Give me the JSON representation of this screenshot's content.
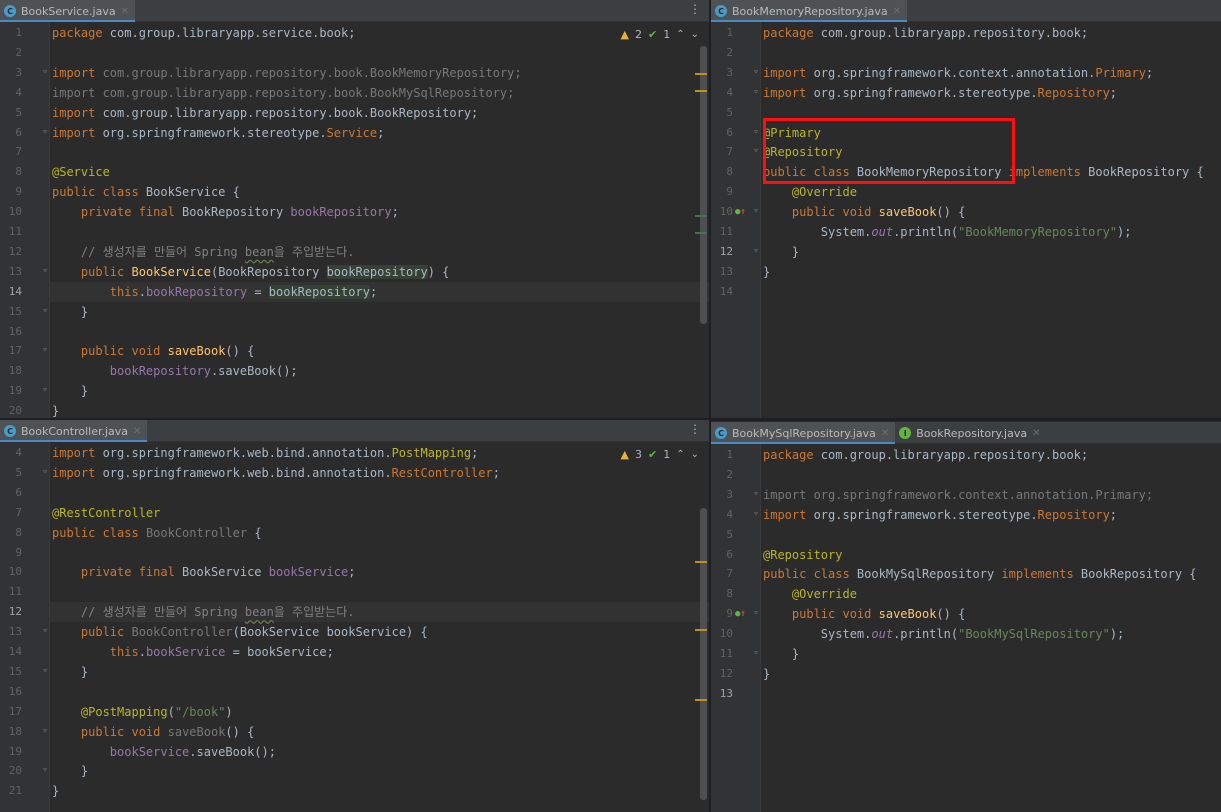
{
  "panes": {
    "tl": {
      "tabs": [
        {
          "label": "BookService.java",
          "kind": "class",
          "active": true
        }
      ],
      "inspection": {
        "warnings": "2",
        "ok": "1"
      },
      "lines": [
        {
          "n": "1",
          "html": "<span class=\"kw\">package</span> com.group.libraryapp.service.book;"
        },
        {
          "n": "2",
          "html": ""
        },
        {
          "n": "3",
          "html": "<span class=\"unused\"><span class=\"kw\">import</span> com.group.libraryapp.repository.book.BookMemoryRepository;</span>",
          "fold": true
        },
        {
          "n": "4",
          "html": "<span class=\"unused\">import com.group.libraryapp.repository.book.BookMySqlRepository;</span>"
        },
        {
          "n": "5",
          "html": "<span class=\"kw\">import</span> com.group.libraryapp.repository.book.BookRepository;"
        },
        {
          "n": "6",
          "html": "<span class=\"kw\">import</span> org.springframework.stereotype.<span class=\"kw\">Service</span>;",
          "fold": true
        },
        {
          "n": "7",
          "html": ""
        },
        {
          "n": "8",
          "html": "<span class=\"ann\">@Service</span>"
        },
        {
          "n": "9",
          "html": "<span class=\"kw\">public class</span> BookService {"
        },
        {
          "n": "10",
          "html": "    <span class=\"kw\">private final</span> BookRepository <span class=\"fld\">bookRepository</span>;"
        },
        {
          "n": "11",
          "html": ""
        },
        {
          "n": "12",
          "html": "    <span class=\"cmt\">// 생성자를 만들어 Spring <span class=\"und\">bean</span>을 주입받는다.</span>"
        },
        {
          "n": "13",
          "html": "    <span class=\"kw\">public</span> <span class=\"fn\">BookService</span>(BookRepository <span class=\"hl\">bookRepository</span>) {",
          "fold": true
        },
        {
          "n": "14",
          "html": "        <span class=\"kw\">this</span>.<span class=\"fld\">bookRepository</span> = <span class=\"hl\">bookRepository</span>;",
          "current": true
        },
        {
          "n": "15",
          "html": "    }",
          "fold": true
        },
        {
          "n": "16",
          "html": ""
        },
        {
          "n": "17",
          "html": "    <span class=\"kw\">public void</span> <span class=\"fn\">saveBook</span>() {",
          "fold": true
        },
        {
          "n": "18",
          "html": "        <span class=\"fld\">bookRepository</span>.saveBook();"
        },
        {
          "n": "19",
          "html": "    }",
          "fold": true
        },
        {
          "n": "20",
          "html": "}"
        }
      ]
    },
    "tr": {
      "tabs": [
        {
          "label": "BookMemoryRepository.java",
          "kind": "class",
          "active": true
        }
      ],
      "lines": [
        {
          "n": "1",
          "html": "<span class=\"kw\">package</span> com.group.libraryapp.repository.book;"
        },
        {
          "n": "2",
          "html": ""
        },
        {
          "n": "3",
          "html": "<span class=\"kw\">import</span> org.springframework.context.annotation.<span class=\"kw\">Primary</span>;",
          "fold": true
        },
        {
          "n": "4",
          "html": "<span class=\"kw\">import</span> org.springframework.stereotype.<span class=\"kw\">Repository</span>;",
          "fold": true
        },
        {
          "n": "5",
          "html": ""
        },
        {
          "n": "6",
          "html": "<span class=\"ann\">@Primary</span>",
          "fold": true
        },
        {
          "n": "7",
          "html": "<span class=\"ann\">@Repository</span>",
          "fold": true
        },
        {
          "n": "8",
          "html": "<span class=\"kw\">public class</span> BookMemoryRepository <span class=\"kw\">implements</span> BookRepository {"
        },
        {
          "n": "9",
          "html": "    <span class=\"ann\">@Override</span>"
        },
        {
          "n": "10",
          "html": "    <span class=\"kw\">public void</span> <span class=\"fn\">saveBook</span>() {",
          "fold": true,
          "impl": true
        },
        {
          "n": "11",
          "html": "        System.<span class=\"ital\">out</span>.println(<span class=\"str\">\"BookMemoryRepository\"</span>);"
        },
        {
          "n": "12",
          "html": "    }",
          "fold": true,
          "cur": true
        },
        {
          "n": "13",
          "html": "}"
        },
        {
          "n": "14",
          "html": ""
        }
      ]
    },
    "bl": {
      "tabs": [
        {
          "label": "BookController.java",
          "kind": "class",
          "active": true
        }
      ],
      "inspection": {
        "warnings": "3",
        "ok": "1"
      },
      "lines": [
        {
          "n": "4",
          "html": "<span class=\"kw\">import</span> org.springframework.web.bind.annotation.<span class=\"ann\">PostMapping</span>;"
        },
        {
          "n": "5",
          "html": "<span class=\"kw\">import</span> org.springframework.web.bind.annotation.<span class=\"kw\">RestController</span>;",
          "fold": true
        },
        {
          "n": "6",
          "html": ""
        },
        {
          "n": "7",
          "html": "<span class=\"ann\">@RestController</span>"
        },
        {
          "n": "8",
          "html": "<span class=\"kw\">public class</span> <span class=\"unused\">BookController</span> {"
        },
        {
          "n": "9",
          "html": ""
        },
        {
          "n": "10",
          "html": "    <span class=\"kw\">private final</span> BookService <span class=\"fld\">bookService</span>;"
        },
        {
          "n": "11",
          "html": ""
        },
        {
          "n": "12",
          "html": "    <span class=\"cmt\">// 생성자를 만들어 Spring <span class=\"und\">bean</span>을 주입받는다.</span>",
          "current": true
        },
        {
          "n": "13",
          "html": "    <span class=\"kw\">public</span> <span class=\"unused\">BookController</span>(BookService bookService) {",
          "fold": true
        },
        {
          "n": "14",
          "html": "        <span class=\"kw\">this</span>.<span class=\"fld\">bookService</span> = bookService;"
        },
        {
          "n": "15",
          "html": "    }",
          "fold": true
        },
        {
          "n": "16",
          "html": ""
        },
        {
          "n": "17",
          "html": "    <span class=\"ann\">@PostMapping</span>(<span class=\"str\">\"/book\"</span>)"
        },
        {
          "n": "18",
          "html": "    <span class=\"kw\">public void</span> <span class=\"unused\">saveBook</span>() {",
          "fold": true
        },
        {
          "n": "19",
          "html": "        <span class=\"fld\">bookService</span>.saveBook();"
        },
        {
          "n": "20",
          "html": "    }",
          "fold": true
        },
        {
          "n": "21",
          "html": "}"
        }
      ]
    },
    "br": {
      "tabs": [
        {
          "label": "BookMySqlRepository.java",
          "kind": "class",
          "active": true
        },
        {
          "label": "BookRepository.java",
          "kind": "iface",
          "active": false
        }
      ],
      "lines": [
        {
          "n": "1",
          "html": "<span class=\"kw\">package</span> com.group.libraryapp.repository.book;"
        },
        {
          "n": "2",
          "html": ""
        },
        {
          "n": "3",
          "html": "<span class=\"unused\">import org.springframework.context.annotation.Primary;</span>",
          "fold": true
        },
        {
          "n": "4",
          "html": "<span class=\"kw\">import</span> org.springframework.stereotype.<span class=\"kw\">Repository</span>;",
          "fold": true
        },
        {
          "n": "5",
          "html": ""
        },
        {
          "n": "6",
          "html": "<span class=\"ann\">@Repository</span>"
        },
        {
          "n": "7",
          "html": "<span class=\"kw\">public class</span> BookMySqlRepository <span class=\"kw\">implements</span> BookRepository {"
        },
        {
          "n": "8",
          "html": "    <span class=\"ann\">@Override</span>"
        },
        {
          "n": "9",
          "html": "    <span class=\"kw\">public void</span> <span class=\"fn\">saveBook</span>() {",
          "fold": true,
          "impl": true
        },
        {
          "n": "10",
          "html": "        System.<span class=\"ital\">out</span>.println(<span class=\"str\">\"BookMySqlRepository\"</span>);"
        },
        {
          "n": "11",
          "html": "    }",
          "fold": true
        },
        {
          "n": "12",
          "html": "}"
        },
        {
          "n": "13",
          "html": "",
          "cur": true
        }
      ]
    }
  }
}
